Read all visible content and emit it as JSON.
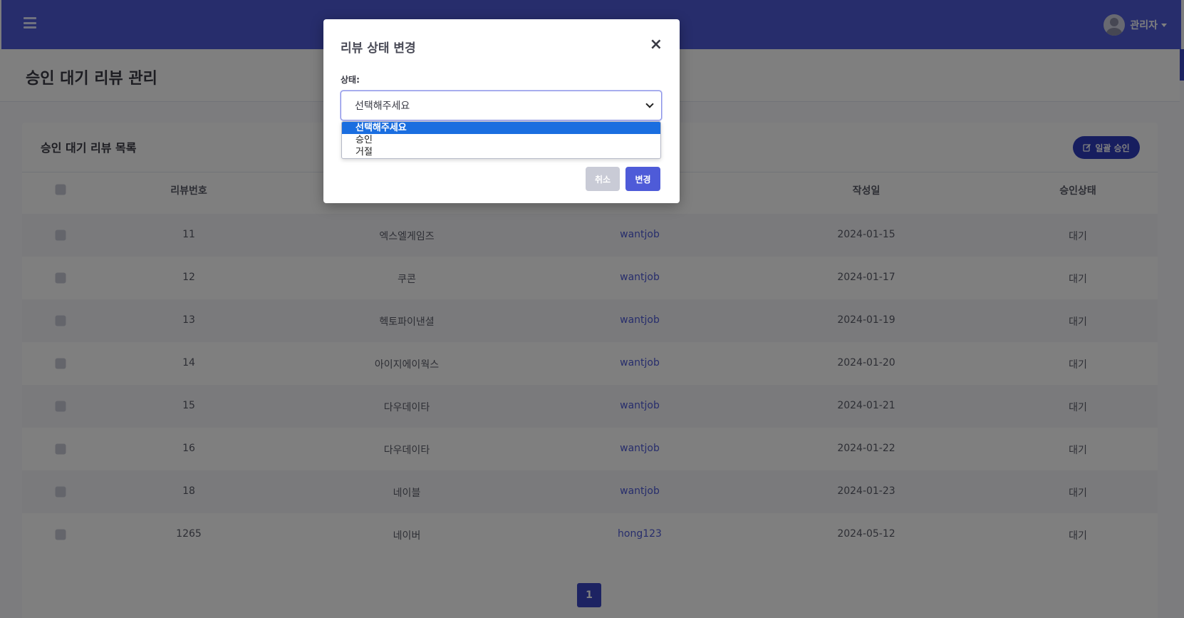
{
  "topbar": {
    "user_name": "관리자"
  },
  "page": {
    "title": "승인 대기 리뷰 관리"
  },
  "card": {
    "title": "승인 대기 리뷰 목록",
    "bulk_approve_label": "일괄 승인"
  },
  "table": {
    "headers": {
      "review_no": "리뷰번호",
      "created": "작성일",
      "status": "승인상태"
    },
    "rows": [
      {
        "review_no": "11",
        "company": "엑스엘게임즈",
        "writer": "wantjob",
        "date": "2024-01-15",
        "status": "대기"
      },
      {
        "review_no": "12",
        "company": "쿠콘",
        "writer": "wantjob",
        "date": "2024-01-17",
        "status": "대기"
      },
      {
        "review_no": "13",
        "company": "헥토파이낸셜",
        "writer": "wantjob",
        "date": "2024-01-19",
        "status": "대기"
      },
      {
        "review_no": "14",
        "company": "아이지에이웍스",
        "writer": "wantjob",
        "date": "2024-01-20",
        "status": "대기"
      },
      {
        "review_no": "15",
        "company": "다우데이타",
        "writer": "wantjob",
        "date": "2024-01-21",
        "status": "대기"
      },
      {
        "review_no": "16",
        "company": "다우데이타",
        "writer": "wantjob",
        "date": "2024-01-22",
        "status": "대기"
      },
      {
        "review_no": "18",
        "company": "네이블",
        "writer": "wantjob",
        "date": "2024-01-23",
        "status": "대기"
      },
      {
        "review_no": "1265",
        "company": "네이버",
        "writer": "hong123",
        "date": "2024-05-12",
        "status": "대기"
      }
    ]
  },
  "pagination": {
    "current": "1"
  },
  "modal": {
    "title": "리뷰 상태 변경",
    "close_symbol": "×",
    "status_label": "상태:",
    "selected_value": "선택해주세요",
    "options": [
      "선택해주세요",
      "승인",
      "거절"
    ],
    "cancel_label": "취소",
    "change_label": "변경"
  },
  "colors": {
    "primary": "#4e5bd8",
    "selected_option": "#1a6ee0"
  },
  "icons": {
    "menu": "hamburger-icon",
    "bulk": "edit-icon",
    "close": "close-icon"
  }
}
